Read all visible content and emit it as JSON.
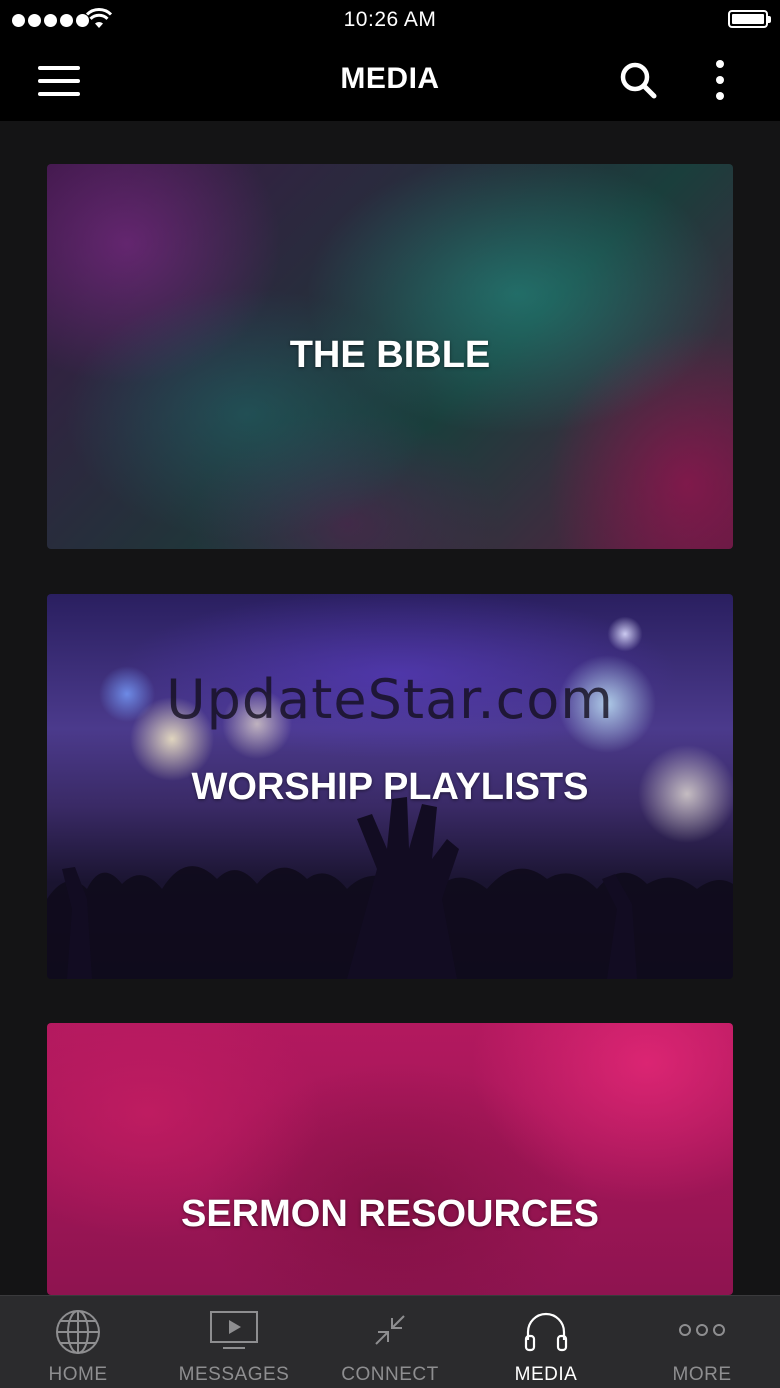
{
  "status_bar": {
    "time": "10:26 AM"
  },
  "nav": {
    "title": "MEDIA",
    "icons": [
      "hamburger-menu-icon",
      "search-icon",
      "more-vertical-icon"
    ]
  },
  "cards": [
    {
      "label": "THE BIBLE"
    },
    {
      "label": "WORSHIP PLAYLISTS"
    },
    {
      "label": "SERMON RESOURCES"
    }
  ],
  "watermark": "UpdateStar.com",
  "tabs": [
    {
      "label": "HOME",
      "icon": "globe-icon",
      "active": false
    },
    {
      "label": "MESSAGES",
      "icon": "video-player-icon",
      "active": false
    },
    {
      "label": "CONNECT",
      "icon": "compress-arrows-icon",
      "active": false
    },
    {
      "label": "MEDIA",
      "icon": "headphones-icon",
      "active": true
    },
    {
      "label": "MORE",
      "icon": "more-dots-icon",
      "active": false
    }
  ],
  "colors": {
    "background": "#141415",
    "bar": "#000000",
    "tab_bar": "#2b2b2d",
    "tab_inactive": "#8e8e90",
    "tab_active": "#ffffff"
  }
}
